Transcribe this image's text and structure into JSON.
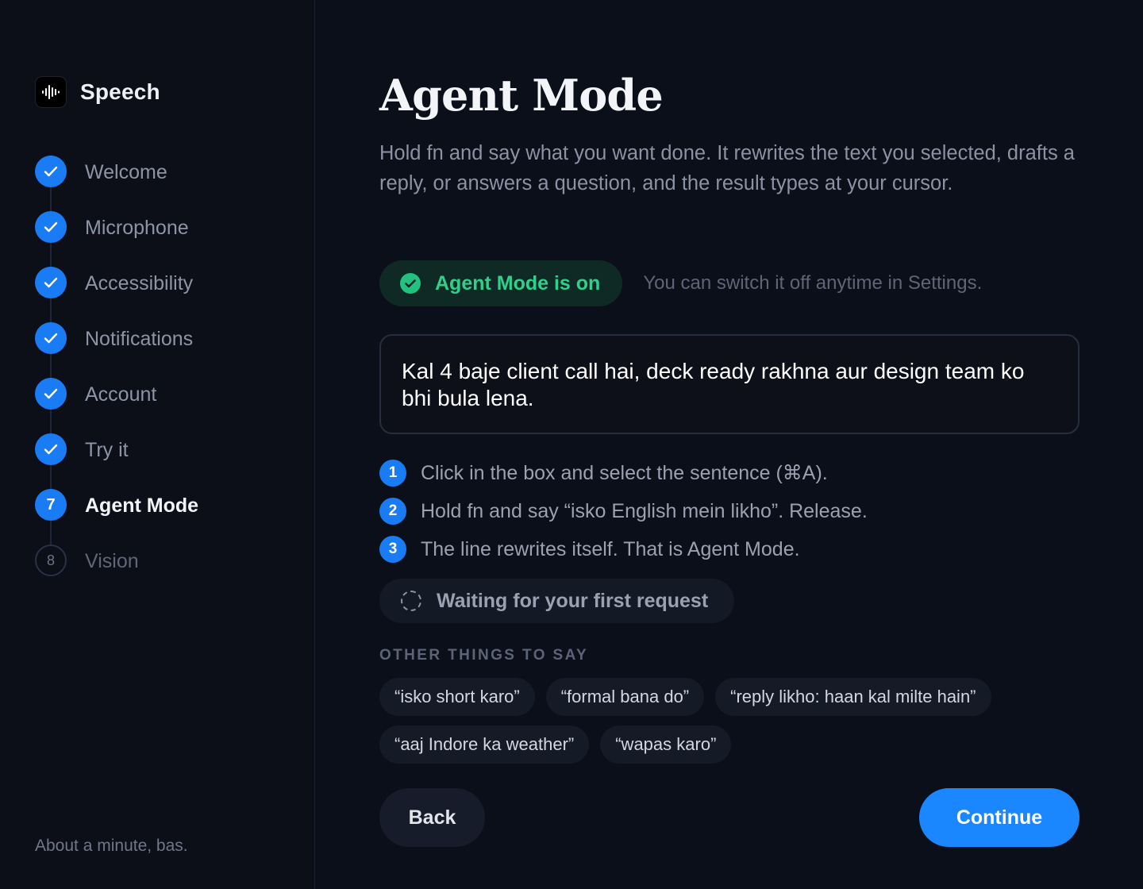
{
  "brand": {
    "name": "Speech",
    "icon": "waveform-icon"
  },
  "steps": [
    {
      "label": "Welcome",
      "status": "done"
    },
    {
      "label": "Microphone",
      "status": "done"
    },
    {
      "label": "Accessibility",
      "status": "done"
    },
    {
      "label": "Notifications",
      "status": "done"
    },
    {
      "label": "Account",
      "status": "done"
    },
    {
      "label": "Try it",
      "status": "done"
    },
    {
      "label": "Agent Mode",
      "status": "active",
      "number": "7"
    },
    {
      "label": "Vision",
      "status": "pending",
      "number": "8"
    }
  ],
  "sidebar_footer": "About a minute, bas.",
  "main": {
    "title": "Agent Mode",
    "description": "Hold fn and say what you want done. It rewrites the text you selected, drafts a reply, or answers a question, and the result types at your cursor.",
    "status_label": "Agent Mode is on",
    "status_hint": "You can switch it off anytime in Settings.",
    "demo_text": "Kal 4 baje client call hai, deck ready rakhna aur design team ko bhi bula lena.",
    "instructions": [
      {
        "num": "1",
        "text": "Click in the box and select the sentence (⌘A)."
      },
      {
        "num": "2",
        "text": "Hold fn and say “isko English mein likho”. Release."
      },
      {
        "num": "3",
        "text": "The line rewrites itself. That is Agent Mode."
      }
    ],
    "waiting_label": "Waiting for your first request",
    "other_title": "OTHER THINGS TO SAY",
    "suggestions_row1": [
      "“isko short karo”",
      "“formal bana do”",
      "“reply likho: haan kal milte hain”"
    ],
    "suggestions_row2": [
      "“aaj Indore ka weather”",
      "“wapas karo”"
    ],
    "back_label": "Back",
    "continue_label": "Continue"
  },
  "colors": {
    "accent": "#1a86ff",
    "success": "#2fd08c",
    "background": "#0b0f19"
  }
}
